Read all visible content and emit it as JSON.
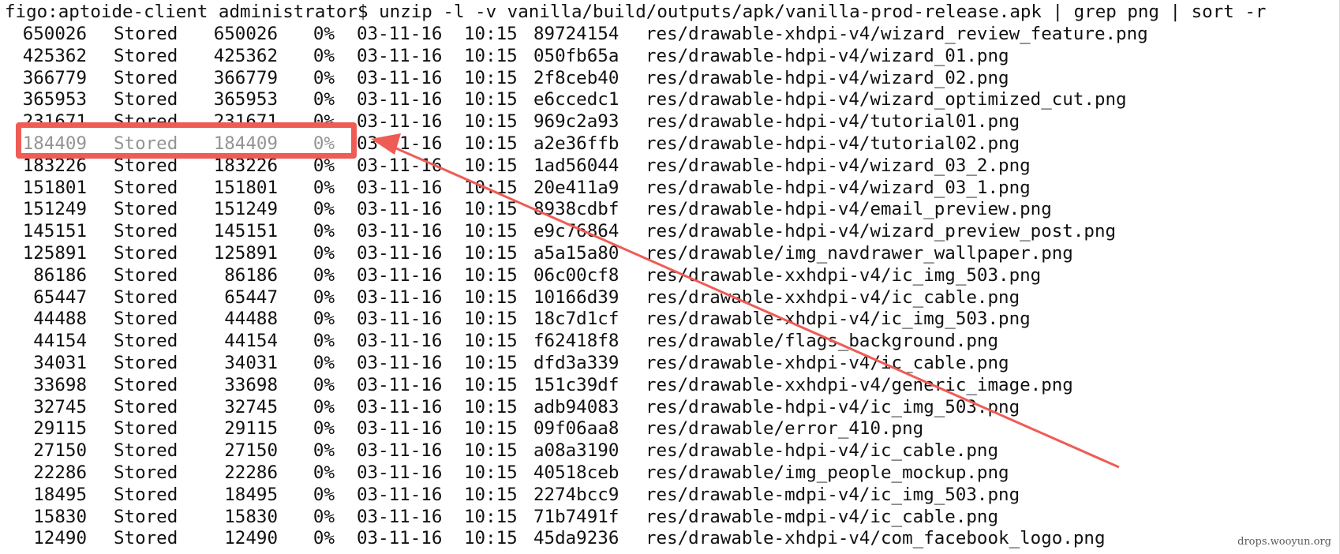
{
  "terminal": {
    "command": "figo:aptoide-client administrator$ unzip -l -v vanilla/build/outputs/apk/vanilla-prod-release.apk | grep png | sort -r",
    "rows": [
      {
        "length": "650026",
        "method": "Stored",
        "size": "650026",
        "cmpr": "0%",
        "date": "03-11-16",
        "time": "10:15",
        "crc": "89724154",
        "name": "res/drawable-xhdpi-v4/wizard_review_feature.png"
      },
      {
        "length": "425362",
        "method": "Stored",
        "size": "425362",
        "cmpr": "0%",
        "date": "03-11-16",
        "time": "10:15",
        "crc": "050fb65a",
        "name": "res/drawable-hdpi-v4/wizard_01.png"
      },
      {
        "length": "366779",
        "method": "Stored",
        "size": "366779",
        "cmpr": "0%",
        "date": "03-11-16",
        "time": "10:15",
        "crc": "2f8ceb40",
        "name": "res/drawable-hdpi-v4/wizard_02.png"
      },
      {
        "length": "365953",
        "method": "Stored",
        "size": "365953",
        "cmpr": "0%",
        "date": "03-11-16",
        "time": "10:15",
        "crc": "e6ccedc1",
        "name": "res/drawable-hdpi-v4/wizard_optimized_cut.png"
      },
      {
        "length": "231671",
        "method": "Stored",
        "size": "231671",
        "cmpr": "0%",
        "date": "03-11-16",
        "time": "10:15",
        "crc": "969c2a93",
        "name": "res/drawable-hdpi-v4/tutorial01.png"
      },
      {
        "length": "184409",
        "method": "Stored",
        "size": "184409",
        "cmpr": "0%",
        "date": "03-11-16",
        "time": "10:15",
        "crc": "a2e36ffb",
        "name": "res/drawable-hdpi-v4/tutorial02.png"
      },
      {
        "length": "183226",
        "method": "Stored",
        "size": "183226",
        "cmpr": "0%",
        "date": "03-11-16",
        "time": "10:15",
        "crc": "1ad56044",
        "name": "res/drawable-hdpi-v4/wizard_03_2.png"
      },
      {
        "length": "151801",
        "method": "Stored",
        "size": "151801",
        "cmpr": "0%",
        "date": "03-11-16",
        "time": "10:15",
        "crc": "20e411a9",
        "name": "res/drawable-hdpi-v4/wizard_03_1.png"
      },
      {
        "length": "151249",
        "method": "Stored",
        "size": "151249",
        "cmpr": "0%",
        "date": "03-11-16",
        "time": "10:15",
        "crc": "8938cdbf",
        "name": "res/drawable-hdpi-v4/email_preview.png"
      },
      {
        "length": "145151",
        "method": "Stored",
        "size": "145151",
        "cmpr": "0%",
        "date": "03-11-16",
        "time": "10:15",
        "crc": "e9c76864",
        "name": "res/drawable-hdpi-v4/wizard_preview_post.png"
      },
      {
        "length": "125891",
        "method": "Stored",
        "size": "125891",
        "cmpr": "0%",
        "date": "03-11-16",
        "time": "10:15",
        "crc": "a5a15a80",
        "name": "res/drawable/img_navdrawer_wallpaper.png"
      },
      {
        "length": "86186",
        "method": "Stored",
        "size": "86186",
        "cmpr": "0%",
        "date": "03-11-16",
        "time": "10:15",
        "crc": "06c00cf8",
        "name": "res/drawable-xxhdpi-v4/ic_img_503.png"
      },
      {
        "length": "65447",
        "method": "Stored",
        "size": "65447",
        "cmpr": "0%",
        "date": "03-11-16",
        "time": "10:15",
        "crc": "10166d39",
        "name": "res/drawable-xxhdpi-v4/ic_cable.png"
      },
      {
        "length": "44488",
        "method": "Stored",
        "size": "44488",
        "cmpr": "0%",
        "date": "03-11-16",
        "time": "10:15",
        "crc": "18c7d1cf",
        "name": "res/drawable-xhdpi-v4/ic_img_503.png"
      },
      {
        "length": "44154",
        "method": "Stored",
        "size": "44154",
        "cmpr": "0%",
        "date": "03-11-16",
        "time": "10:15",
        "crc": "f62418f8",
        "name": "res/drawable/flags_background.png"
      },
      {
        "length": "34031",
        "method": "Stored",
        "size": "34031",
        "cmpr": "0%",
        "date": "03-11-16",
        "time": "10:15",
        "crc": "dfd3a339",
        "name": "res/drawable-xhdpi-v4/ic_cable.png"
      },
      {
        "length": "33698",
        "method": "Stored",
        "size": "33698",
        "cmpr": "0%",
        "date": "03-11-16",
        "time": "10:15",
        "crc": "151c39df",
        "name": "res/drawable-xxhdpi-v4/generic_image.png"
      },
      {
        "length": "32745",
        "method": "Stored",
        "size": "32745",
        "cmpr": "0%",
        "date": "03-11-16",
        "time": "10:15",
        "crc": "adb94083",
        "name": "res/drawable-hdpi-v4/ic_img_503.png"
      },
      {
        "length": "29115",
        "method": "Stored",
        "size": "29115",
        "cmpr": "0%",
        "date": "03-11-16",
        "time": "10:15",
        "crc": "09f06aa8",
        "name": "res/drawable/error_410.png"
      },
      {
        "length": "27150",
        "method": "Stored",
        "size": "27150",
        "cmpr": "0%",
        "date": "03-11-16",
        "time": "10:15",
        "crc": "a08a3190",
        "name": "res/drawable-hdpi-v4/ic_cable.png"
      },
      {
        "length": "22286",
        "method": "Stored",
        "size": "22286",
        "cmpr": "0%",
        "date": "03-11-16",
        "time": "10:15",
        "crc": "40518ceb",
        "name": "res/drawable/img_people_mockup.png"
      },
      {
        "length": "18495",
        "method": "Stored",
        "size": "18495",
        "cmpr": "0%",
        "date": "03-11-16",
        "time": "10:15",
        "crc": "2274bcc9",
        "name": "res/drawable-mdpi-v4/ic_img_503.png"
      },
      {
        "length": "15830",
        "method": "Stored",
        "size": "15830",
        "cmpr": "0%",
        "date": "03-11-16",
        "time": "10:15",
        "crc": "71b7491f",
        "name": "res/drawable-mdpi-v4/ic_cable.png"
      },
      {
        "length": "12490",
        "method": "Stored",
        "size": "12490",
        "cmpr": "0%",
        "date": "03-11-16",
        "time": "10:15",
        "crc": "45da9236",
        "name": "res/drawable-xhdpi-v4/com_facebook_logo.png"
      }
    ]
  },
  "annotation": {
    "highlighted_row": 5,
    "color": "#ee5c55"
  },
  "watermark": "drops.wooyun.org"
}
